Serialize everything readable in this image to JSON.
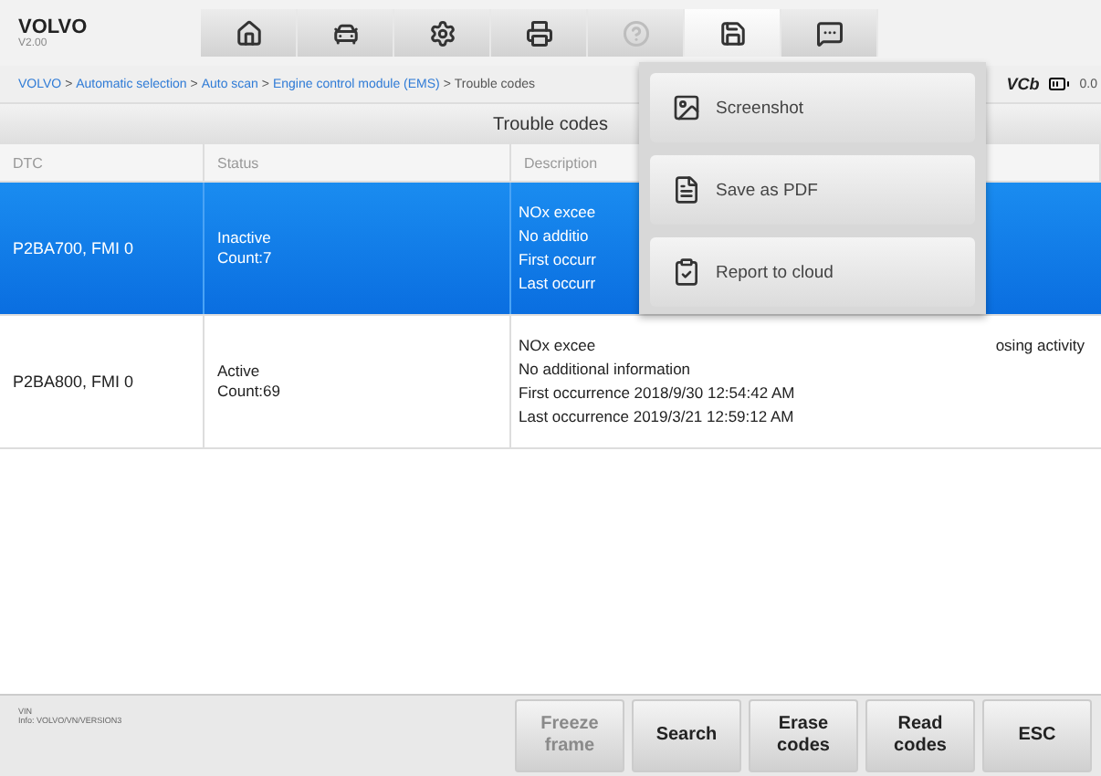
{
  "brand": {
    "name": "VOLVO",
    "version": "V2.00"
  },
  "toolbar": [
    {
      "kind": "home",
      "selected": false,
      "disabled": false
    },
    {
      "kind": "vehicle",
      "selected": false,
      "disabled": false
    },
    {
      "kind": "settings",
      "selected": false,
      "disabled": false
    },
    {
      "kind": "print",
      "selected": false,
      "disabled": false
    },
    {
      "kind": "help",
      "selected": false,
      "disabled": true
    },
    {
      "kind": "save",
      "selected": true,
      "disabled": false
    },
    {
      "kind": "message",
      "selected": false,
      "disabled": false
    }
  ],
  "breadcrumb": {
    "links": [
      "VOLVO",
      "Automatic selection",
      "Auto scan",
      "Engine control module (EMS)"
    ],
    "separator": ">",
    "current": "Trouble codes"
  },
  "status": {
    "vci": "VCb",
    "battery": "0.0"
  },
  "table": {
    "title": "Trouble codes",
    "columns": [
      "DTC",
      "Status",
      "Description"
    ],
    "rows": [
      {
        "selected": true,
        "dtc": "P2BA700, FMI 0",
        "status": "Inactive",
        "count": "Count:7",
        "lines": [
          {
            "text": "NOx excee"
          },
          {
            "text": "No additio"
          },
          {
            "text": "First occurr"
          },
          {
            "text": "Last occurr"
          }
        ]
      },
      {
        "selected": false,
        "dtc": "P2BA800, FMI 0",
        "status": "Active",
        "count": "Count:69",
        "lines": [
          {
            "text": "NOx excee",
            "tail": "osing activity"
          },
          {
            "text": "No additional information"
          },
          {
            "text": "First occurrence 2018/9/30 12:54:42 AM"
          },
          {
            "text": "Last occurrence 2019/3/21 12:59:12 AM"
          }
        ]
      }
    ]
  },
  "save_menu": [
    {
      "kind": "image",
      "label": "Screenshot"
    },
    {
      "kind": "pdf",
      "label": "Save as PDF"
    },
    {
      "kind": "cloud",
      "label": "Report to cloud"
    }
  ],
  "footer": {
    "vin_label": "VIN",
    "info": "Info: VOLVO/VN/VERSION3"
  },
  "buttons": [
    {
      "label": "Freeze frame",
      "disabled": true
    },
    {
      "label": "Search",
      "disabled": false
    },
    {
      "label": "Erase codes",
      "disabled": false
    },
    {
      "label": "Read codes",
      "disabled": false
    },
    {
      "label": "ESC",
      "disabled": false
    }
  ]
}
